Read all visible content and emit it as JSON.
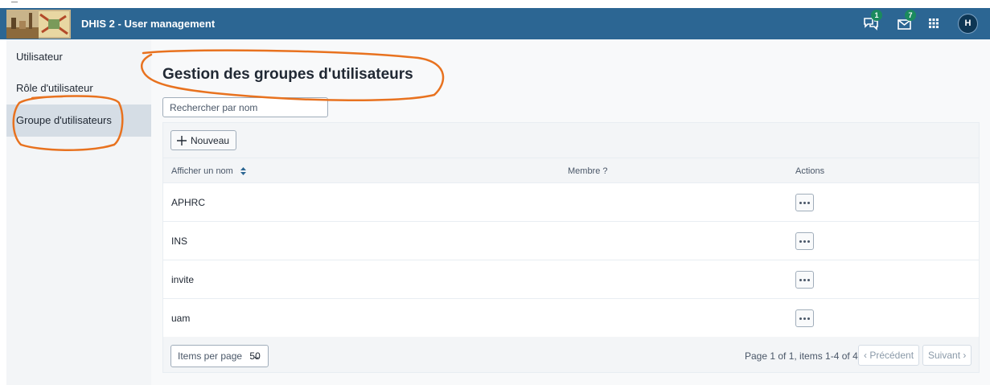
{
  "header": {
    "app_title": "DHIS 2 - User management",
    "messages_count": "1",
    "interpretations_count": "7",
    "avatar_initial": "H",
    "bar_color": "#2c6693"
  },
  "sidebar": {
    "items": [
      {
        "label": "Utilisateur",
        "active": false
      },
      {
        "label": "Rôle d'utilisateur",
        "active": false
      },
      {
        "label": "Groupe d'utilisateurs",
        "active": true
      }
    ]
  },
  "main": {
    "title": "Gestion des groupes d'utilisateurs",
    "search_placeholder": "Rechercher par nom",
    "new_button_label": "Nouveau",
    "columns": {
      "name": "Afficher un nom",
      "member": "Membre ?",
      "actions": "Actions"
    },
    "rows": [
      {
        "name": "APHRC"
      },
      {
        "name": "INS"
      },
      {
        "name": "invite"
      },
      {
        "name": "uam"
      }
    ],
    "pagination": {
      "items_per_page_label": "Items per page",
      "items_per_page_value": "50",
      "summary": "Page 1 of 1, items 1-4 of 4",
      "previous_label": "‹ Précédent",
      "next_label": "Suivant ›"
    }
  },
  "annotation_color": "#e8721f"
}
